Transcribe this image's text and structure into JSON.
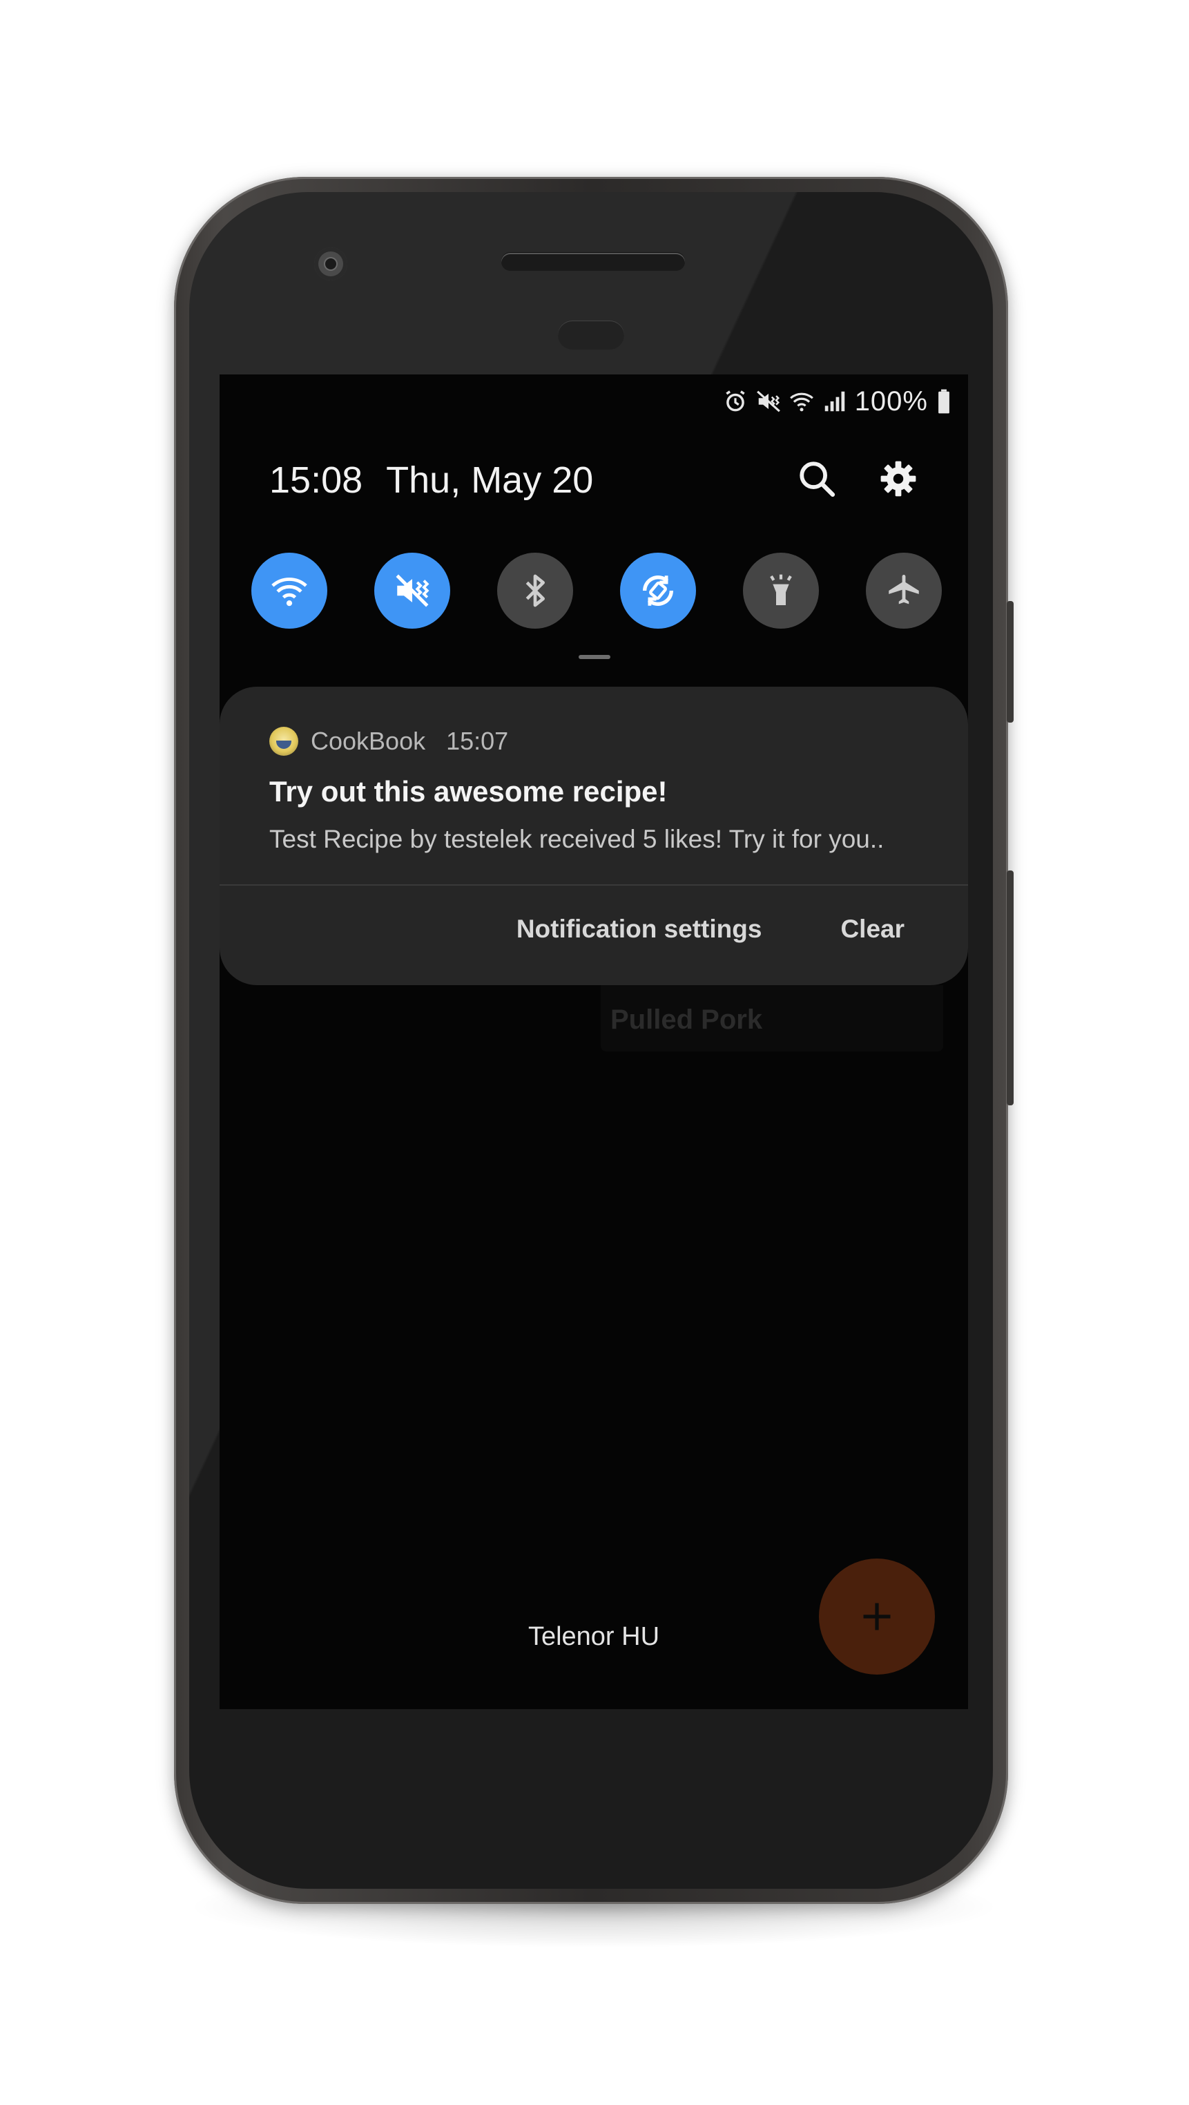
{
  "status_bar": {
    "battery_percent": "100%",
    "icons": [
      "alarm-icon",
      "mute-icon",
      "wifi-signal-icon",
      "cell-signal-icon",
      "battery-icon"
    ]
  },
  "header": {
    "time": "15:08",
    "date": "Thu, May 20",
    "icons": [
      "search-icon",
      "settings-gear-icon"
    ]
  },
  "quick_settings": [
    {
      "name": "wifi",
      "icon": "wifi-icon",
      "on": true
    },
    {
      "name": "mute",
      "icon": "mute-icon",
      "on": true
    },
    {
      "name": "bluetooth",
      "icon": "bluetooth-icon",
      "on": false
    },
    {
      "name": "auto-rotate",
      "icon": "rotate-icon",
      "on": true
    },
    {
      "name": "flashlight",
      "icon": "flashlight-icon",
      "on": false
    },
    {
      "name": "airplane",
      "icon": "airplane-icon",
      "on": false
    }
  ],
  "notification": {
    "app_name": "CookBook",
    "time": "15:07",
    "title": "Try out this awesome recipe!",
    "body": "Test Recipe by testelek received 5 likes! Try it for you..",
    "actions": {
      "settings_label": "Notification settings",
      "clear_label": "Clear"
    }
  },
  "background_app": {
    "card_title": "Pulled Pork",
    "carrier": "Telenor HU",
    "fab_icon": "plus-icon"
  },
  "colors": {
    "accent_on": "#3f95f5",
    "toggle_off": "#454545",
    "card_bg": "#262626",
    "fab": "#4a200c"
  }
}
